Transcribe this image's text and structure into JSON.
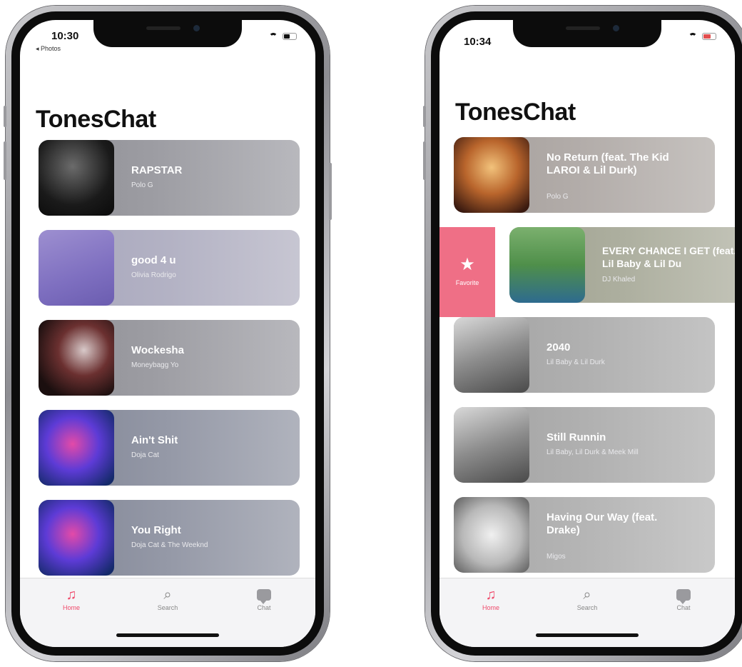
{
  "phones": [
    {
      "time": "10:30",
      "back_label": "◂ Photos",
      "app_title": "TonesChat",
      "songs": [
        {
          "title": "RAPSTAR",
          "artist": "Polo G"
        },
        {
          "title": "good 4 u",
          "artist": "Olivia Rodrigo"
        },
        {
          "title": "Wockesha",
          "artist": "Moneybagg Yo"
        },
        {
          "title": "Ain't Shit",
          "artist": "Doja Cat"
        },
        {
          "title": "You Right",
          "artist": "Doja Cat & The Weeknd"
        }
      ],
      "tabs": [
        {
          "label": "Home"
        },
        {
          "label": "Search"
        },
        {
          "label": "Chat"
        }
      ]
    },
    {
      "time": "10:34",
      "app_title": "TonesChat",
      "favorite_action": "Favorite",
      "songs": [
        {
          "title": "No Return (feat. The Kid LAROI & Lil Durk)",
          "artist": "Polo G"
        },
        {
          "title": "EVERY CHANCE I GET (feat. Lil Baby & Lil Du",
          "artist": "DJ Khaled"
        },
        {
          "title": "2040",
          "artist": "Lil Baby & Lil Durk"
        },
        {
          "title": "Still Runnin",
          "artist": "Lil Baby, Lil Durk & Meek Mill"
        },
        {
          "title": "Having Our Way (feat. Drake)",
          "artist": "Migos"
        }
      ],
      "tabs": [
        {
          "label": "Home"
        },
        {
          "label": "Search"
        },
        {
          "label": "Chat"
        }
      ]
    }
  ],
  "colors": {
    "accent": "#ef4a6b",
    "favorite_bg": "#ef6f86"
  }
}
